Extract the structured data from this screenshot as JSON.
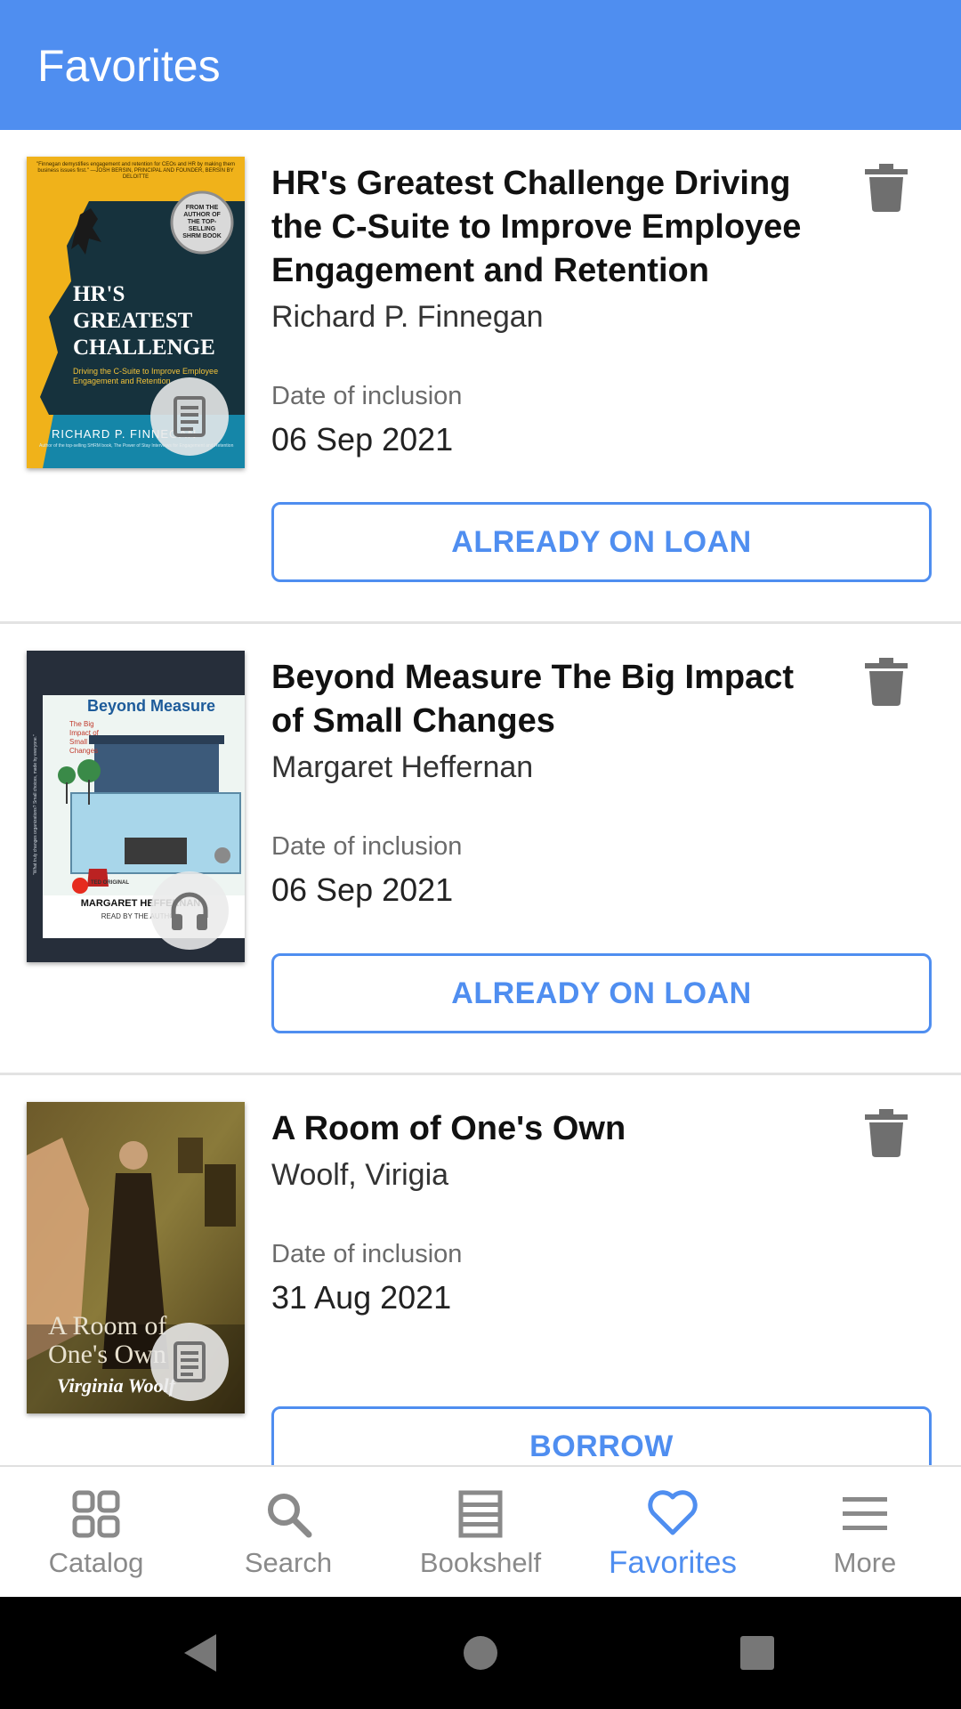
{
  "header": {
    "title": "Favorites"
  },
  "books": [
    {
      "title": "HR's Greatest Challenge Driving the C-Suite to Improve Employee Engagement and Retention",
      "author": "Richard P. Finnegan",
      "date_label": "Date of inclusion",
      "date": "06 Sep 2021",
      "action": "ALREADY ON LOAN",
      "format_icon": "document-icon",
      "cover": {
        "blurb": "\"Finnegan demystifies engagement and retention for CEOs and HR by making them business issues first.\" —JOSH BERSIN, PRINCIPAL AND FOUNDER, BERSIN BY DELOITTE",
        "seal": "FROM THE AUTHOR OF THE TOP-SELLING SHRM BOOK",
        "title_line1": "HR'S",
        "title_line2": "GREATEST",
        "title_line3": "CHALLENGE",
        "subtitle": "Driving the C-Suite to Improve Employee Engagement and Retention",
        "author": "RICHARD P. FINNEGAN",
        "footnote": "Author of the top-selling SHRM book, The Power of Stay Interviews for Engagement and Retention"
      }
    },
    {
      "title": "Beyond Measure The Big Impact of Small Changes",
      "author": "Margaret Heffernan",
      "date_label": "Date of inclusion",
      "date": "06 Sep 2021",
      "action": "ALREADY ON LOAN",
      "format_icon": "headphones-icon",
      "cover": {
        "title": "Beyond Measure",
        "subtitle": "The Big Impact of Small Changes",
        "side": "\"What truly changes organizations? Small choices, made by everyone.\"",
        "series": "TED ORIGINAL",
        "author": "MARGARET HEFFERNAN",
        "reader": "READ BY THE AUTHOR"
      }
    },
    {
      "title": "A Room of One's Own",
      "author": "Woolf, Virigia",
      "date_label": "Date of inclusion",
      "date": "31 Aug 2021",
      "action": "BORROW",
      "format_icon": "document-icon",
      "cover": {
        "title": "A Room of One's Own",
        "author": "Virginia Woolf"
      }
    }
  ],
  "bottom_nav": [
    {
      "label": "Catalog",
      "icon": "grid-icon",
      "active": false
    },
    {
      "label": "Search",
      "icon": "search-icon",
      "active": false
    },
    {
      "label": "Bookshelf",
      "icon": "bookshelf-icon",
      "active": false
    },
    {
      "label": "Favorites",
      "icon": "heart-icon",
      "active": true
    },
    {
      "label": "More",
      "icon": "menu-icon",
      "active": false
    }
  ],
  "colors": {
    "accent": "#4f8ef0",
    "divider": "#e3e3e3",
    "inactive": "#8a8a8a",
    "trash": "#6f6f6f"
  }
}
